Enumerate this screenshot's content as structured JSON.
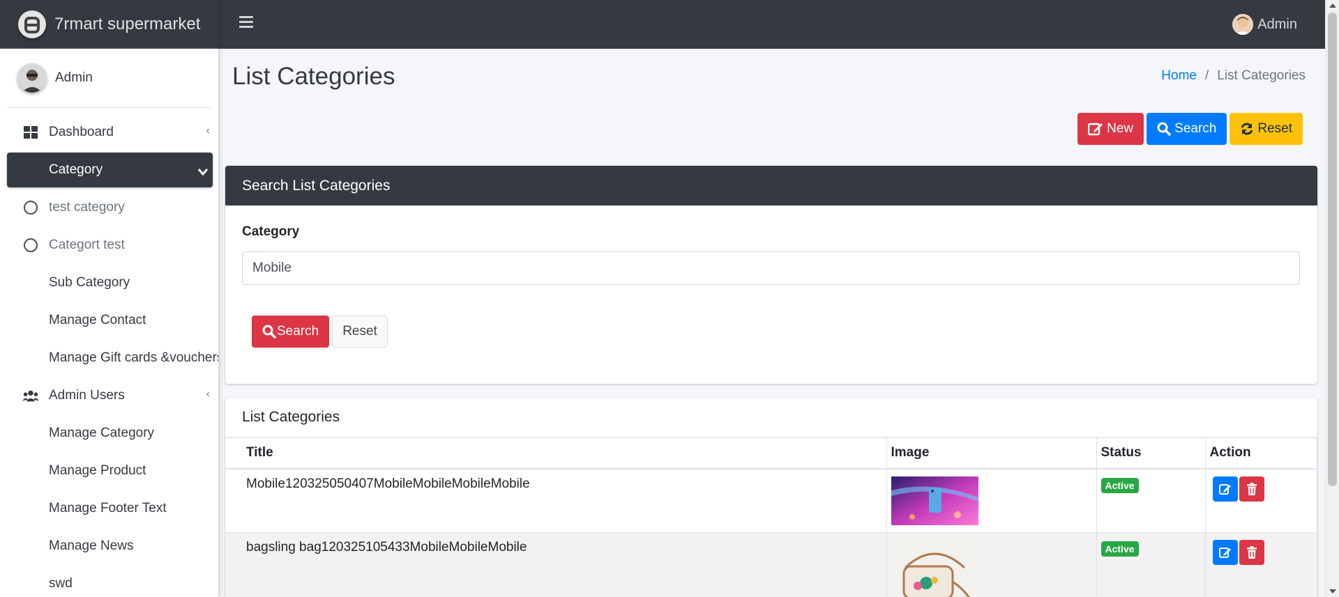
{
  "brand": {
    "name": "7rmart supermarket"
  },
  "sidebar": {
    "user_name": "Admin",
    "items": [
      {
        "label": "Dashboard",
        "icon": "dashboard-icon",
        "angle": "‹"
      },
      {
        "label": "Category",
        "icon": "",
        "angle": "",
        "active": true
      },
      {
        "label": "test category",
        "icon": "circle-icon"
      },
      {
        "label": "Categort test",
        "icon": "circle-icon"
      },
      {
        "label": "Sub Category"
      },
      {
        "label": "Manage Contact"
      },
      {
        "label": "Manage Gift cards &vouchers"
      },
      {
        "label": "Admin Users",
        "icon": "users-icon",
        "angle": "‹"
      },
      {
        "label": "Manage Category"
      },
      {
        "label": "Manage Product"
      },
      {
        "label": "Manage Footer Text"
      },
      {
        "label": "Manage News"
      },
      {
        "label": "swd"
      }
    ]
  },
  "topbar": {
    "user_name": "Admin"
  },
  "page": {
    "title": "List Categories",
    "breadcrumb": {
      "home": "Home",
      "separator": "/",
      "current": "List Categories"
    },
    "actions": {
      "new": "New",
      "search": "Search",
      "reset": "Reset"
    }
  },
  "search_card": {
    "header": "Search List Categories",
    "field_label": "Category",
    "field_value": "Mobile",
    "search_button": "Search",
    "reset_button": "Reset"
  },
  "list_card": {
    "title": "List Categories",
    "columns": [
      "Title",
      "Image",
      "Status",
      "Action"
    ],
    "rows": [
      {
        "title": "Mobile120325050407MobileMobileMobileMobile",
        "image": "phone-image",
        "status": "Active"
      },
      {
        "title": "bagsling bag120325105433MobileMobileMobile",
        "image": "bag-image",
        "status": "Active"
      }
    ]
  },
  "colors": {
    "dark": "#343a40",
    "primary": "#007bff",
    "danger": "#dc3545",
    "warning": "#ffc107",
    "success": "#28a745"
  }
}
